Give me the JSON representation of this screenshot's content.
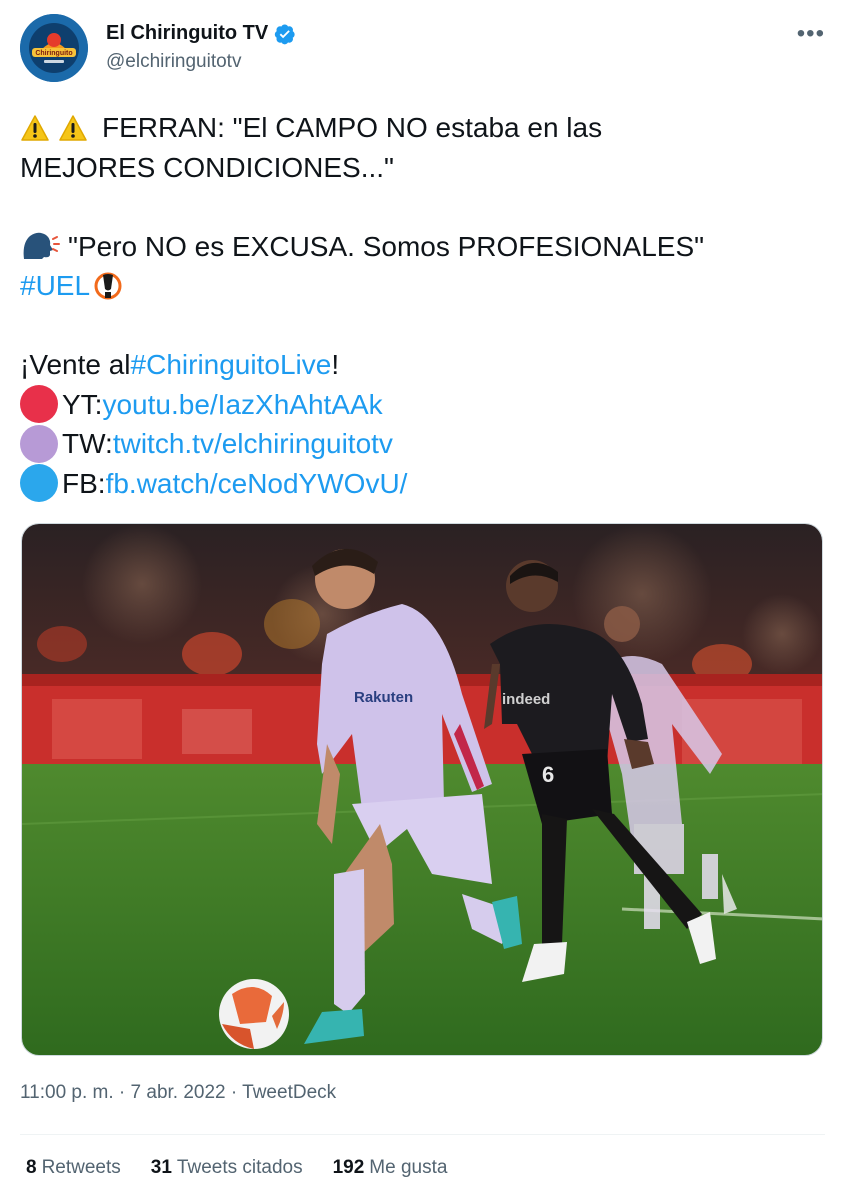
{
  "author": {
    "display_name": "El Chiringuito TV",
    "handle": "@elchiringuitotv",
    "avatar_text": "Chiringuito",
    "verified": true
  },
  "more_label": "•••",
  "tweet": {
    "line1": "FERRAN: \"El CAMPO NO estaba en las",
    "line2": "MEJORES CONDICIONES...\"",
    "line3": "\"Pero NO es EXCUSA. Somos PROFESIONALES\"",
    "hashtag_uel": "#UEL",
    "vente_prefix": "¡Vente al ",
    "hashtag_live": "#ChiringuitoLive",
    "vente_suffix": "!",
    "yt_label": "YT: ",
    "yt_link": "youtu.be/IazXhAhtAAk",
    "tw_label": "TW: ",
    "tw_link": "twitch.tv/elchiringuitotv",
    "fb_label": "FB: ",
    "fb_link": "fb.watch/ceNodYWOvU/"
  },
  "icons": {
    "warning": "warning-icon",
    "speaking_head": "speaking-head-icon",
    "trophy": "trophy-icon",
    "red_circle": "#e8304a",
    "purple_circle": "#b79ad6",
    "blue_circle": "#2ba7ec"
  },
  "media": {
    "jersey_text_player": "Rakuten",
    "jersey_text_opponent": "indeed",
    "opponent_number": "6"
  },
  "meta": {
    "timestamp": "11:00 p. m. · 7 abr. 2022 · TweetDeck"
  },
  "stats": {
    "retweets_count": "8",
    "retweets_label": "Retweets",
    "quotes_count": "31",
    "quotes_label": "Tweets citados",
    "likes_count": "192",
    "likes_label": "Me gusta"
  },
  "colors": {
    "link": "#1d9bf0",
    "text": "#0f1419",
    "secondary": "#536471",
    "verified": "#1d9bf0"
  }
}
